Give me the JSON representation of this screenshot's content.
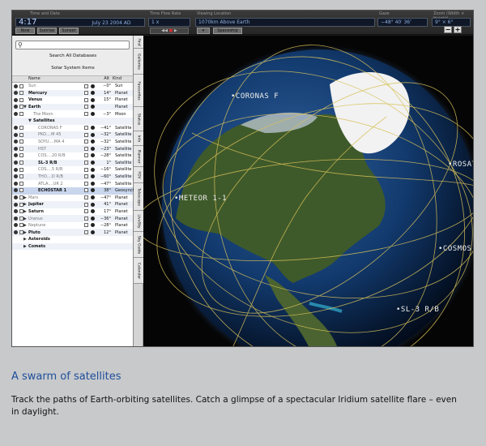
{
  "toolbar": {
    "time_label": "Time and Date",
    "time_value": "4:17",
    "date_value": "July 23  2004 AD",
    "flow_label": "Time Flow Rate",
    "flow_value": "1 x",
    "location_label": "Viewing Location",
    "location_value": "1070km Above Earth",
    "gaze_label": "Gaze",
    "gaze_value": "−48° 40′ 36″",
    "zoom_label": "Zoom (Width × Height)",
    "zoom_value": "9° × 6°",
    "now_label": "Now",
    "sunrise_label": "Sunrise",
    "sunset_label": "Sunset",
    "spaceship_label": "Spaceship",
    "zoom_out_label": "−",
    "zoom_in_label": "+"
  },
  "sidebar": {
    "search_placeholder": "",
    "search_all_label": "Search All Databases",
    "items_title": "Solar System Items",
    "col_name": "Name",
    "col_alt": "Alt",
    "col_kind": "Kind",
    "rows": [
      {
        "name": "Sun",
        "alt": "−0°",
        "kind": "Sun",
        "indent": 1,
        "disc": "",
        "grey": true
      },
      {
        "name": "Mercury",
        "alt": "14°",
        "kind": "Planet",
        "indent": 1,
        "disc": "",
        "grey": false
      },
      {
        "name": "Venus",
        "alt": "15°",
        "kind": "Planet",
        "indent": 1,
        "disc": "",
        "grey": false
      },
      {
        "name": "Earth",
        "alt": "",
        "kind": "Planet",
        "indent": 1,
        "disc": "▼",
        "grey": false
      },
      {
        "name": "The Moon",
        "alt": "−3°",
        "kind": "Moon",
        "indent": 2,
        "disc": "",
        "grey": true
      },
      {
        "name": "Satellites",
        "alt": "",
        "kind": "",
        "indent": 2,
        "disc": "▼",
        "grey": false,
        "nobox": true
      },
      {
        "name": "CORONAS F",
        "alt": "−41°",
        "kind": "Satellite",
        "indent": 3,
        "disc": "",
        "grey": true
      },
      {
        "name": "PKO....M 45",
        "alt": "−32°",
        "kind": "Satellite",
        "indent": 3,
        "disc": "",
        "grey": true
      },
      {
        "name": "SOYU....MA 4",
        "alt": "−32°",
        "kind": "Satellite",
        "indent": 3,
        "disc": "",
        "grey": true
      },
      {
        "name": "HST",
        "alt": "−23°",
        "kind": "Satellite",
        "indent": 3,
        "disc": "",
        "grey": true
      },
      {
        "name": "COS....20 R/B",
        "alt": "−28°",
        "kind": "Satellite",
        "indent": 3,
        "disc": "",
        "grey": true
      },
      {
        "name": "SL-3 R/B",
        "alt": "1°",
        "kind": "Satellite",
        "indent": 3,
        "disc": "",
        "grey": false
      },
      {
        "name": "COS....5 R/B",
        "alt": "−16°",
        "kind": "Satellite",
        "indent": 3,
        "disc": "",
        "grey": true
      },
      {
        "name": "THO....D R/B",
        "alt": "−60°",
        "kind": "Satellite",
        "indent": 3,
        "disc": "",
        "grey": true
      },
      {
        "name": "ATLA....UR 2",
        "alt": "−47°",
        "kind": "Satellite",
        "indent": 3,
        "disc": "",
        "grey": true
      },
      {
        "name": "ECHOSTAR 1",
        "alt": "38°",
        "kind": "Geosynchron...",
        "indent": 3,
        "disc": "",
        "grey": false,
        "sel": true
      },
      {
        "name": "Mars",
        "alt": "−47°",
        "kind": "Planet",
        "indent": 1,
        "disc": "▶",
        "grey": true
      },
      {
        "name": "Jupiter",
        "alt": "41°",
        "kind": "Planet",
        "indent": 1,
        "disc": "▶",
        "grey": false
      },
      {
        "name": "Saturn",
        "alt": "17°",
        "kind": "Planet",
        "indent": 1,
        "disc": "▶",
        "grey": false
      },
      {
        "name": "Uranus",
        "alt": "−36°",
        "kind": "Planet",
        "indent": 1,
        "disc": "▶",
        "grey": true
      },
      {
        "name": "Neptune",
        "alt": "−28°",
        "kind": "Planet",
        "indent": 1,
        "disc": "▶",
        "grey": true
      },
      {
        "name": "Pluto",
        "alt": "12°",
        "kind": "Planet",
        "indent": 1,
        "disc": "▶",
        "grey": false
      },
      {
        "name": "Asteroids",
        "alt": "",
        "kind": "",
        "indent": 1,
        "disc": "▶",
        "grey": false,
        "nobox": true
      },
      {
        "name": "Comets",
        "alt": "",
        "kind": "",
        "indent": 1,
        "disc": "▶",
        "grey": false,
        "nobox": true
      }
    ]
  },
  "tabs": [
    "Find",
    "Galleries",
    "Favourites",
    "Status",
    "Info",
    "Planner",
    "FOV",
    "Telescope",
    "LiveSky",
    "Sky Guide",
    "Calendar"
  ],
  "sky": {
    "labels": {
      "coronas": "•CORONAS F",
      "rosat": "•ROSAT",
      "meteor": "•METEOR 1-1",
      "cosmos": "•COSMOS",
      "sl3": "•SL-3 R/B"
    },
    "orbit_color": "#d9c25a",
    "ocean_color": "#123a6e",
    "land_color": "#3f5a2a"
  },
  "caption": {
    "title": "A swarm of satellites",
    "text": "Track the paths of Earth-orbiting satellites. Catch a glimpse of a spectacular Iridium satellite flare – even in daylight."
  }
}
